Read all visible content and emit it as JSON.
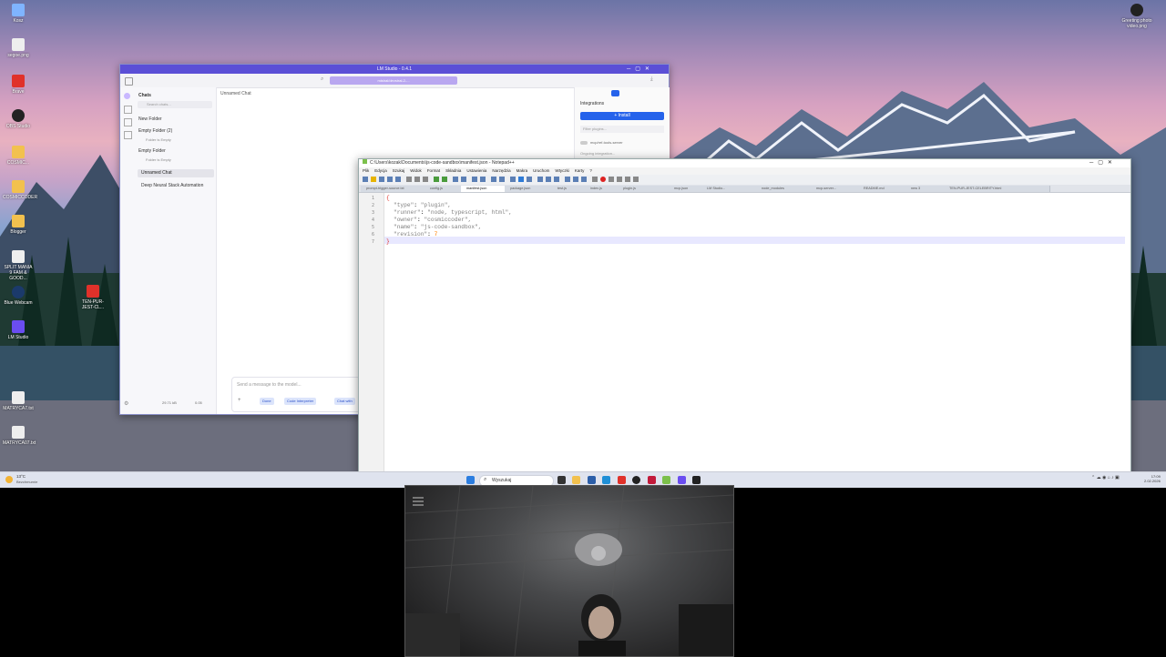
{
  "desktop": {
    "icons_left": [
      {
        "label": "Kosz",
        "icon": "recycle-bin-icon",
        "color": "#7fb4ff"
      },
      {
        "label": "segoe.png",
        "icon": "file-icon",
        "color": "#eeeeee"
      },
      {
        "label": "Brave",
        "icon": "brave-icon",
        "color": "#e0312a"
      },
      {
        "label": "OBS Studio",
        "icon": "obs-icon",
        "color": "#222222"
      },
      {
        "label": "COSMIC...",
        "icon": "folder-icon",
        "color": "#f2c14e"
      },
      {
        "label": "COSMICCODER",
        "icon": "folder-icon",
        "color": "#f2c14e"
      },
      {
        "label": "Blogger",
        "icon": "folder-icon",
        "color": "#f2c14e"
      },
      {
        "label": "SPLIT MANIA 9 FAM & GOOD...",
        "icon": "file-icon",
        "color": "#eeeeee"
      },
      {
        "label": "Blue Webcam",
        "icon": "webcam-icon",
        "color": "#1b3a6b"
      },
      {
        "label": "LM Studio",
        "icon": "lm-studio-icon",
        "color": "#6a4df0"
      },
      {
        "label": "MATRYCA7.txt",
        "icon": "file-icon",
        "color": "#eeeeee"
      },
      {
        "label": "MATRYCA07.txt",
        "icon": "file-icon",
        "color": "#eeeeee"
      }
    ],
    "icon_center": {
      "label": "TEN-PUR-JEST-CL...",
      "icon": "brave-icon",
      "color": "#e0312a"
    },
    "icon_right": {
      "label": "Greeting photo video.png",
      "icon": "obs-icon",
      "color": "#222222"
    }
  },
  "lmstudio": {
    "title": "LM Studio - 0.4.1",
    "model_selector": "mistral/devstral-2-...",
    "sidebar": {
      "heading": "Chats",
      "search_placeholder": "Search chats...",
      "new_folder": "New Folder",
      "folder1": "Empty Folder (2)",
      "folder1_sub": "Folder is Empty",
      "folder2": "Empty Folder",
      "folder2_sub": "Folder is Empty",
      "chat_item": "Unnamed Chat",
      "chat_item2": "Deep Neural Stack Automation",
      "footer_a": "29.71 kB",
      "footer_b": "0.05"
    },
    "chat_title": "Unnamed Chat",
    "input_placeholder": "Send a message to the model...",
    "chips": [
      "Done",
      "Code Interpreter",
      "Chat with"
    ],
    "right_panel": {
      "integrations": "Integrations",
      "install_label": "+ Install",
      "filter_placeholder": "Filter plugins...",
      "toggle_label": "mcp/ref-tools-server",
      "note": "Ongoing integration..."
    }
  },
  "notepad": {
    "title": "C:\\Users\\kozak\\Documents\\js-code-sandbox\\manifest.json - Notepad++",
    "menu": [
      "Plik",
      "Edycja",
      "Szukaj",
      "Widok",
      "Format",
      "Składnia",
      "Ustawienia",
      "Narzędzia",
      "Makra",
      "Uruchom",
      "Wtyczki",
      "Karty",
      "?"
    ],
    "tabs": [
      "prompt-trigger-source.txt",
      "config.js",
      "manifest.json",
      "package.json",
      "test.js",
      "index.js",
      "plugin.js",
      "mcp.json",
      "LM Studio...",
      "node_modules",
      "mcp-server...",
      "README.md",
      "new 3",
      "TEN-PUR-JEST-CELEBRITY.html"
    ],
    "active_tab": "manifest.json",
    "lines": [
      {
        "no": "1",
        "text": "{"
      },
      {
        "no": "2",
        "key": "\"type\"",
        "val": "\"plugin\","
      },
      {
        "no": "3",
        "key": "\"runner\"",
        "val": "\"node, typescript, html\","
      },
      {
        "no": "4",
        "key": "\"owner\"",
        "val": "\"cosmiccoder\","
      },
      {
        "no": "5",
        "key": "\"name\"",
        "val": "\"js-code-sandbox\","
      },
      {
        "no": "6",
        "key": "\"revision\"",
        "val": "7"
      },
      {
        "no": "7",
        "text": "}"
      }
    ]
  },
  "taskbar": {
    "weather_temp": "13°C",
    "weather_desc": "Bezchmurnie",
    "search_placeholder": "Wyszukaj",
    "time": "17:09",
    "date": "2.02.2026"
  }
}
